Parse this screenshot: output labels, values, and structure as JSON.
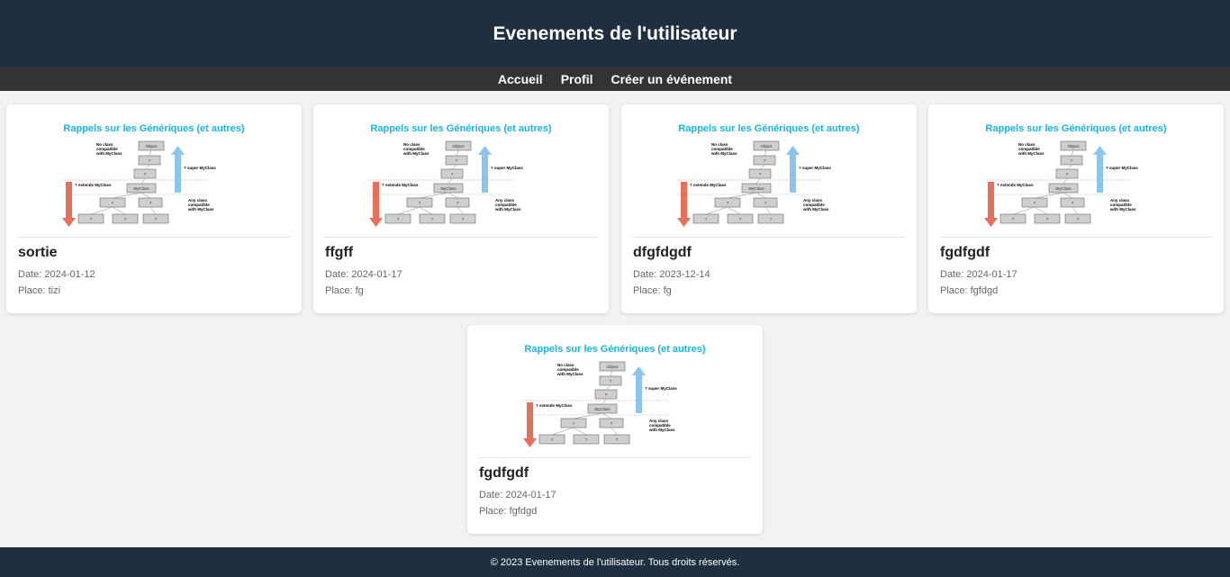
{
  "header": {
    "title": "Evenements de l'utilisateur"
  },
  "nav": {
    "items": [
      "Accueil",
      "Profil",
      "Créer un événement"
    ]
  },
  "thumbnail": {
    "title": "Rappels sur les Génériques (et autres)",
    "no_class": [
      "No class",
      "compatible",
      "with MyClass"
    ],
    "object_label": "Object",
    "myclass_label": "MyClass",
    "q": "?",
    "super_label": "? super MyClass",
    "extends_label": "? extends MyClass",
    "any_class": [
      "Any class",
      "compatible",
      "with MyClass"
    ]
  },
  "events": [
    {
      "name": "sortie",
      "date": "Date: 2024-01-12",
      "place": "Place: tizi"
    },
    {
      "name": "ffgff",
      "date": "Date: 2024-01-17",
      "place": "Place: fg"
    },
    {
      "name": "dfgfdgdf",
      "date": "Date: 2023-12-14",
      "place": "Place: fg"
    },
    {
      "name": "fgdfgdf",
      "date": "Date: 2024-01-17",
      "place": "Place: fgfdgd"
    },
    {
      "name": "fgdfgdf",
      "date": "Date: 2024-01-17",
      "place": "Place: fgfdgd"
    }
  ],
  "footer": {
    "text": "© 2023 Evenements de l'utilisateur. Tous droits réservés."
  },
  "colors": {
    "header_bg": "#1f2f40",
    "nav_bg": "#333333",
    "title_cyan": "#19b5e0",
    "arrow_red": "#e8705a",
    "arrow_blue": "#8cc4ee"
  }
}
